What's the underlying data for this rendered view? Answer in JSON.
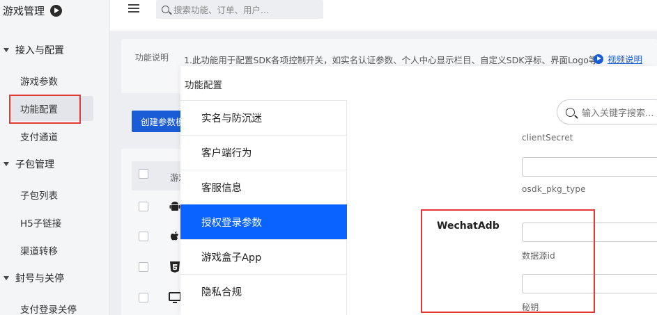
{
  "sidebar": {
    "brand": "游戏管理",
    "groups": [
      {
        "label": "接入与配置",
        "items": [
          "游戏参数",
          "功能配置",
          "支付通道"
        ]
      },
      {
        "label": "子包管理",
        "items": [
          "子包列表",
          "H5子链接",
          "渠道转移"
        ]
      },
      {
        "label": "封号与关停",
        "items": [
          "支付登录关停"
        ]
      }
    ]
  },
  "header": {
    "search_placeholder": "搜索功能、订单、用户..."
  },
  "page": {
    "desc_label": "功能说明",
    "desc_text": "1.此功能用于配置SDK各项控制开关，如实名认证参数、个人中心显示栏目、自定义SDK浮标、界面Logo等。",
    "video_link": "视频说明",
    "create_button": "创建参数模",
    "table_header": "游戏"
  },
  "modal": {
    "title": "功能配置",
    "menu": [
      "实名与防沉迷",
      "客户端行为",
      "客服信息",
      "授权登录参数",
      "游戏盒子App",
      "隐私合规"
    ],
    "active_index": 3,
    "search_placeholder": "输入关键字搜索...",
    "fields_top": [
      "clientSecret",
      "osdk_pkg_type"
    ],
    "section_title": "WechatAdb",
    "section_fields": [
      "数据源id",
      "秘钥"
    ]
  },
  "colors": {
    "primary": "#0b63ff",
    "button_blue": "#1a5cd6",
    "highlight_red": "#e53935"
  }
}
